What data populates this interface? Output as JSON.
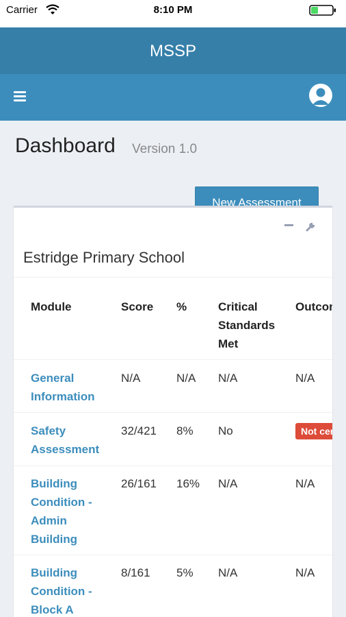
{
  "status_bar": {
    "carrier": "Carrier",
    "time": "8:10 PM"
  },
  "app": {
    "title": "MSSP"
  },
  "page": {
    "title": "Dashboard",
    "subtitle": "Version 1.0"
  },
  "actions": {
    "new_assessment": "New Assessment"
  },
  "box": {
    "title": "Estridge Primary School"
  },
  "table": {
    "headers": {
      "module": "Module",
      "score": "Score",
      "percent": "%",
      "critical": [
        "Critical",
        "Standards",
        "Met"
      ],
      "outcome": "Outcome"
    },
    "rows": [
      {
        "module": [
          "General",
          "Information"
        ],
        "score": "N/A",
        "percent": "N/A",
        "critical": "N/A",
        "outcome": "N/A"
      },
      {
        "module": [
          "Safety",
          "Assessment"
        ],
        "score": "32/421",
        "percent": "8%",
        "critical": "No",
        "outcome": "Not certified"
      },
      {
        "module": [
          "Building",
          "Condition -",
          "Admin",
          "Building"
        ],
        "score": "26/161",
        "percent": "16%",
        "critical": "N/A",
        "outcome": "N/A"
      },
      {
        "module": [
          "Building",
          "Condition -",
          "Block A"
        ],
        "score": "8/161",
        "percent": "5%",
        "critical": "N/A",
        "outcome": "N/A"
      }
    ]
  },
  "colors": {
    "header": "#367fa9",
    "navbar": "#3c8dbc",
    "link": "#3c8dbc",
    "danger": "#dd4b39"
  }
}
